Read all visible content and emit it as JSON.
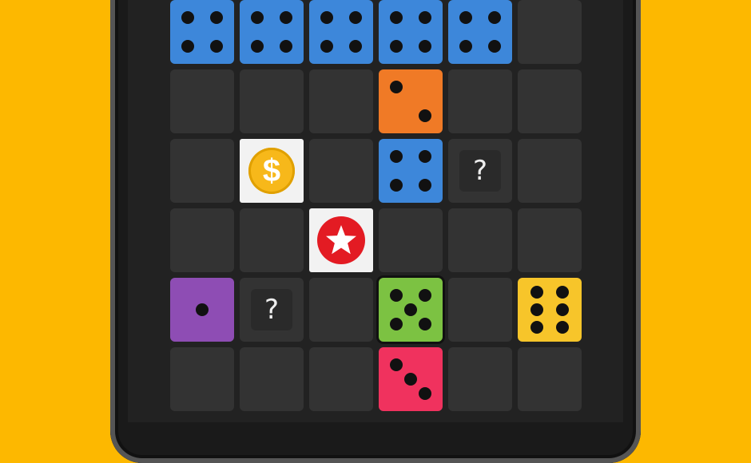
{
  "board": {
    "rows": 6,
    "cols": 6,
    "colors": {
      "blue": "#3D87DA",
      "orange": "#F07A26",
      "purple": "#8E4DB4",
      "green": "#7CC242",
      "red": "#F0325E",
      "yellow": "#F7C52A",
      "empty": "#333333",
      "background": "#FDB800"
    },
    "tiles": [
      {
        "row": 0,
        "col": 0,
        "type": "die",
        "value": 4,
        "color": "blue"
      },
      {
        "row": 0,
        "col": 1,
        "type": "die",
        "value": 4,
        "color": "blue"
      },
      {
        "row": 0,
        "col": 2,
        "type": "die",
        "value": 4,
        "color": "blue"
      },
      {
        "row": 0,
        "col": 3,
        "type": "die",
        "value": 4,
        "color": "blue"
      },
      {
        "row": 0,
        "col": 4,
        "type": "die",
        "value": 4,
        "color": "blue"
      },
      {
        "row": 1,
        "col": 3,
        "type": "die",
        "value": 2,
        "color": "orange"
      },
      {
        "row": 2,
        "col": 1,
        "type": "coin",
        "icon": "dollar-coin-icon"
      },
      {
        "row": 2,
        "col": 3,
        "type": "die",
        "value": 4,
        "color": "blue"
      },
      {
        "row": 2,
        "col": 4,
        "type": "mystery",
        "icon": "question-icon"
      },
      {
        "row": 3,
        "col": 2,
        "type": "star",
        "icon": "star-icon"
      },
      {
        "row": 4,
        "col": 0,
        "type": "die",
        "value": 1,
        "color": "purple"
      },
      {
        "row": 4,
        "col": 1,
        "type": "mystery",
        "icon": "question-icon"
      },
      {
        "row": 4,
        "col": 3,
        "type": "die",
        "value": 5,
        "color": "green",
        "highlighted": true
      },
      {
        "row": 4,
        "col": 5,
        "type": "die",
        "value": 6,
        "color": "yellow"
      },
      {
        "row": 5,
        "col": 3,
        "type": "die",
        "value": 3,
        "color": "red"
      }
    ]
  },
  "labels": {
    "coin_symbol": "$",
    "mystery_symbol": "?"
  }
}
